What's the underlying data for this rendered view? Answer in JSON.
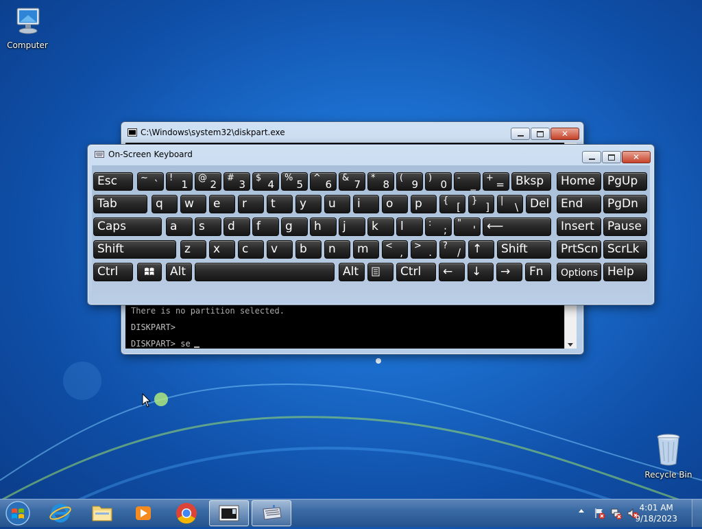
{
  "desktop": {
    "icons": {
      "computer": "Computer",
      "recycle_bin": "Recycle Bin"
    }
  },
  "console_window": {
    "title": "C:\\Windows\\system32\\diskpart.exe",
    "lines": [
      "There is no partition selected.",
      "DISKPART>",
      "DISKPART> se"
    ]
  },
  "osk_window": {
    "title": "On-Screen Keyboard"
  },
  "keyboard": {
    "row1": [
      {
        "name": "key-esc",
        "label": "Esc"
      },
      {
        "name": "key-backtick",
        "up": "~",
        "dn": "`"
      },
      {
        "name": "key-1",
        "up": "!",
        "dn": "1"
      },
      {
        "name": "key-2",
        "up": "@",
        "dn": "2"
      },
      {
        "name": "key-3",
        "up": "#",
        "dn": "3"
      },
      {
        "name": "key-4",
        "up": "$",
        "dn": "4"
      },
      {
        "name": "key-5",
        "up": "%",
        "dn": "5"
      },
      {
        "name": "key-6",
        "up": "^",
        "dn": "6"
      },
      {
        "name": "key-7",
        "up": "&",
        "dn": "7"
      },
      {
        "name": "key-8",
        "up": "*",
        "dn": "8"
      },
      {
        "name": "key-9",
        "up": "(",
        "dn": "9"
      },
      {
        "name": "key-0",
        "up": ")",
        "dn": "0"
      },
      {
        "name": "key-minus",
        "up": "-",
        "dn": "_"
      },
      {
        "name": "key-equals",
        "up": "+",
        "dn": "="
      },
      {
        "name": "key-backspace",
        "label": "Bksp"
      },
      {
        "name": "key-home",
        "label": "Home"
      },
      {
        "name": "key-pgup",
        "label": "PgUp"
      }
    ],
    "row2": [
      {
        "name": "key-tab",
        "label": "Tab"
      },
      {
        "name": "key-q",
        "label": "q"
      },
      {
        "name": "key-w",
        "label": "w"
      },
      {
        "name": "key-e",
        "label": "e"
      },
      {
        "name": "key-r",
        "label": "r"
      },
      {
        "name": "key-t",
        "label": "t"
      },
      {
        "name": "key-y",
        "label": "y"
      },
      {
        "name": "key-u",
        "label": "u"
      },
      {
        "name": "key-i",
        "label": "i"
      },
      {
        "name": "key-o",
        "label": "o"
      },
      {
        "name": "key-p",
        "label": "p"
      },
      {
        "name": "key-lbracket",
        "up": "{",
        "dn": "["
      },
      {
        "name": "key-rbracket",
        "up": "}",
        "dn": "]"
      },
      {
        "name": "key-backslash",
        "up": "|",
        "dn": "\\"
      },
      {
        "name": "key-del",
        "label": "Del"
      },
      {
        "name": "key-end",
        "label": "End"
      },
      {
        "name": "key-pgdn",
        "label": "PgDn"
      }
    ],
    "row3": [
      {
        "name": "key-caps",
        "label": "Caps"
      },
      {
        "name": "key-a",
        "label": "a"
      },
      {
        "name": "key-s",
        "label": "s"
      },
      {
        "name": "key-d",
        "label": "d"
      },
      {
        "name": "key-f",
        "label": "f"
      },
      {
        "name": "key-g",
        "label": "g"
      },
      {
        "name": "key-h",
        "label": "h"
      },
      {
        "name": "key-j",
        "label": "j"
      },
      {
        "name": "key-k",
        "label": "k"
      },
      {
        "name": "key-l",
        "label": "l"
      },
      {
        "name": "key-semicolon",
        "up": ":",
        "dn": ";"
      },
      {
        "name": "key-quote",
        "up": "\"",
        "dn": "'"
      },
      {
        "name": "key-enter",
        "label": "⟵"
      },
      {
        "name": "key-insert",
        "label": "Insert"
      },
      {
        "name": "key-pause",
        "label": "Pause"
      }
    ],
    "row4": [
      {
        "name": "key-shift-left",
        "label": "Shift"
      },
      {
        "name": "key-z",
        "label": "z"
      },
      {
        "name": "key-x",
        "label": "x"
      },
      {
        "name": "key-c",
        "label": "c"
      },
      {
        "name": "key-v",
        "label": "v"
      },
      {
        "name": "key-b",
        "label": "b"
      },
      {
        "name": "key-n",
        "label": "n"
      },
      {
        "name": "key-m",
        "label": "m"
      },
      {
        "name": "key-comma",
        "up": "<",
        "dn": ","
      },
      {
        "name": "key-period",
        "up": ">",
        "dn": "."
      },
      {
        "name": "key-slash",
        "up": "?",
        "dn": "/"
      },
      {
        "name": "key-up-arrow",
        "label": "↑"
      },
      {
        "name": "key-shift-right",
        "label": "Shift"
      },
      {
        "name": "key-prtscn",
        "label": "PrtScn"
      },
      {
        "name": "key-scrlk",
        "label": "ScrLk"
      }
    ],
    "row5": [
      {
        "name": "key-ctrl-left",
        "label": "Ctrl"
      },
      {
        "name": "key-windows",
        "label": ""
      },
      {
        "name": "key-alt-left",
        "label": "Alt"
      },
      {
        "name": "key-space",
        "label": ""
      },
      {
        "name": "key-alt-right",
        "label": "Alt"
      },
      {
        "name": "key-menu",
        "label": ""
      },
      {
        "name": "key-ctrl-right",
        "label": "Ctrl"
      },
      {
        "name": "key-left-arrow",
        "label": "←"
      },
      {
        "name": "key-down-arrow",
        "label": "↓"
      },
      {
        "name": "key-right-arrow",
        "label": "→"
      },
      {
        "name": "key-fn",
        "label": "Fn"
      },
      {
        "name": "key-options",
        "label": "Options"
      },
      {
        "name": "key-help",
        "label": "Help"
      }
    ]
  },
  "taskbar": {
    "clock_time": "4:01 AM",
    "clock_date": "9/18/2023",
    "apps": [
      "start-orb",
      "internet-explorer",
      "windows-explorer",
      "media-player",
      "chrome",
      "diskpart-console",
      "on-screen-keyboard"
    ]
  }
}
